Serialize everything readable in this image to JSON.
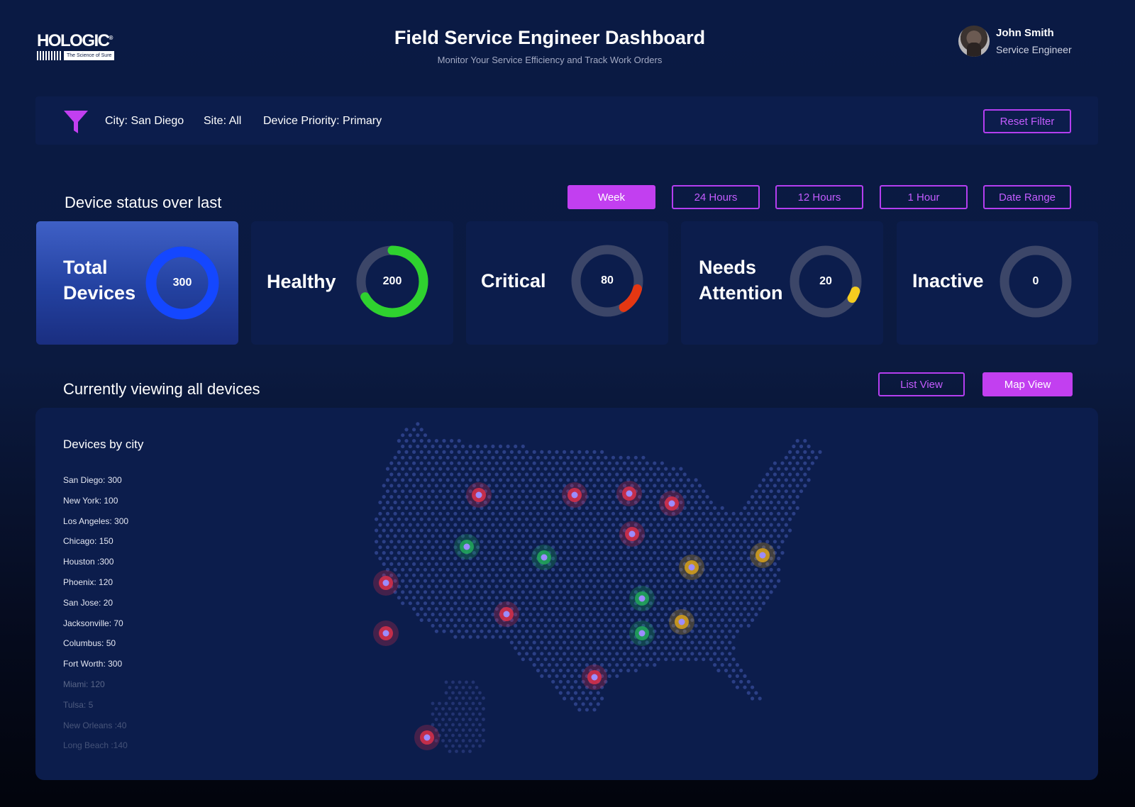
{
  "header": {
    "logo": {
      "word": "HOLOGIC",
      "mark": "®",
      "tagline": "The Science of Sure"
    },
    "title": "Field Service Engineer Dashboard",
    "subtitle": "Monitor Your Service Efficiency and Track Work Orders",
    "user": {
      "name": "John Smith",
      "role": "Service Engineer"
    }
  },
  "filters": {
    "city": "City: San Diego",
    "site": "Site: All",
    "priority": "Device Priority: Primary",
    "reset_label": "Reset Filter",
    "accent_color": "#c23ff0"
  },
  "status": {
    "title": "Device status over last",
    "ranges": [
      {
        "label": "Week",
        "active": true
      },
      {
        "label": "24 Hours",
        "active": false
      },
      {
        "label": "12 Hours",
        "active": false
      },
      {
        "label": "1 Hour",
        "active": false
      },
      {
        "label": "Date Range",
        "active": false
      }
    ],
    "cards": [
      {
        "label_line1": "Total",
        "label_line2": "Devices",
        "value": "300",
        "fraction": 1.0,
        "color": "#1447ff"
      },
      {
        "label_line1": "Healthy",
        "label_line2": "",
        "value": "200",
        "fraction": 0.667,
        "color": "#2fd22f"
      },
      {
        "label_line1": "Critical",
        "label_line2": "",
        "value": "80",
        "fraction": 0.12,
        "color": "#e53712"
      },
      {
        "label_line1": "Needs",
        "label_line2": "Attention",
        "value": "20",
        "fraction": 0.04,
        "color": "#f5cc1f"
      },
      {
        "label_line1": "Inactive",
        "label_line2": "",
        "value": "0",
        "fraction": 0,
        "color": "#3c4668"
      }
    ]
  },
  "devices": {
    "title": "Currently viewing all devices",
    "list_view_label": "List View",
    "map_view_label": "Map View",
    "map_view_active": true
  },
  "cities": {
    "title": "Devices by city",
    "items": [
      "San Diego: 300",
      "New York: 100",
      "Los Angeles: 300",
      "Chicago: 150",
      "Houston :300",
      "Phoenix: 120",
      "San Jose: 20",
      "Jacksonville: 70",
      "Columbus: 50",
      "Fort Worth: 300",
      "Miami: 120",
      "Tulsa: 5",
      "New Orleans :40",
      "Long Beach :140"
    ]
  },
  "map": {
    "dot_color": "#2b3f86",
    "status_colors": {
      "critical": "#d9304a",
      "healthy": "#22a85a",
      "attention": "#d8a21c"
    }
  }
}
